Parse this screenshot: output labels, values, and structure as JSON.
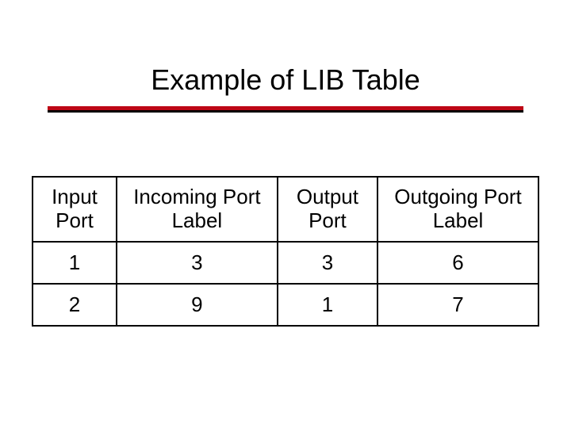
{
  "title": "Example of LIB Table",
  "table": {
    "headers": [
      "Input Port",
      "Incoming Port Label",
      "Output Port",
      "Outgoing Port Label"
    ],
    "rows": [
      [
        "1",
        "3",
        "3",
        "6"
      ],
      [
        "2",
        "9",
        "1",
        "7"
      ]
    ]
  },
  "chart_data": {
    "type": "table",
    "title": "Example of LIB Table",
    "columns": [
      "Input Port",
      "Incoming Port Label",
      "Output Port",
      "Outgoing Port Label"
    ],
    "rows": [
      {
        "Input Port": 1,
        "Incoming Port Label": 3,
        "Output Port": 3,
        "Outgoing Port Label": 6
      },
      {
        "Input Port": 2,
        "Incoming Port Label": 9,
        "Output Port": 1,
        "Outgoing Port Label": 7
      }
    ]
  }
}
